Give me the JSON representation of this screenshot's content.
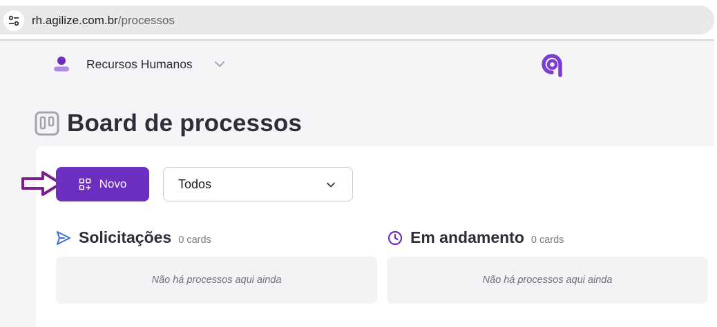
{
  "browser": {
    "url_host": "rh.agilize.com.br",
    "url_path": "/processos",
    "site_info_icon": "tune-icon"
  },
  "header": {
    "org_name": "Recursos Humanos",
    "org_icon": "user-icon",
    "logo": "agilize-logo"
  },
  "page": {
    "title": "Board de processos",
    "title_icon": "board-columns-icon"
  },
  "toolbar": {
    "new_label": "Novo",
    "new_icon": "grid-add-icon",
    "filter_value": "Todos"
  },
  "columns": [
    {
      "name": "Solicitações",
      "count": "0 cards",
      "icon": "send-icon",
      "empty_text": "Não há processos aqui ainda"
    },
    {
      "name": "Em andamento",
      "count": "0 cards",
      "icon": "clock-icon",
      "empty_text": "Não há processos aqui ainda"
    }
  ],
  "colors": {
    "primary": "#6d2fbf",
    "column_icon_blue": "#3b6fd4",
    "column_icon_purple": "#6d2fbf",
    "annotation_arrow": "#7a1d8e"
  }
}
